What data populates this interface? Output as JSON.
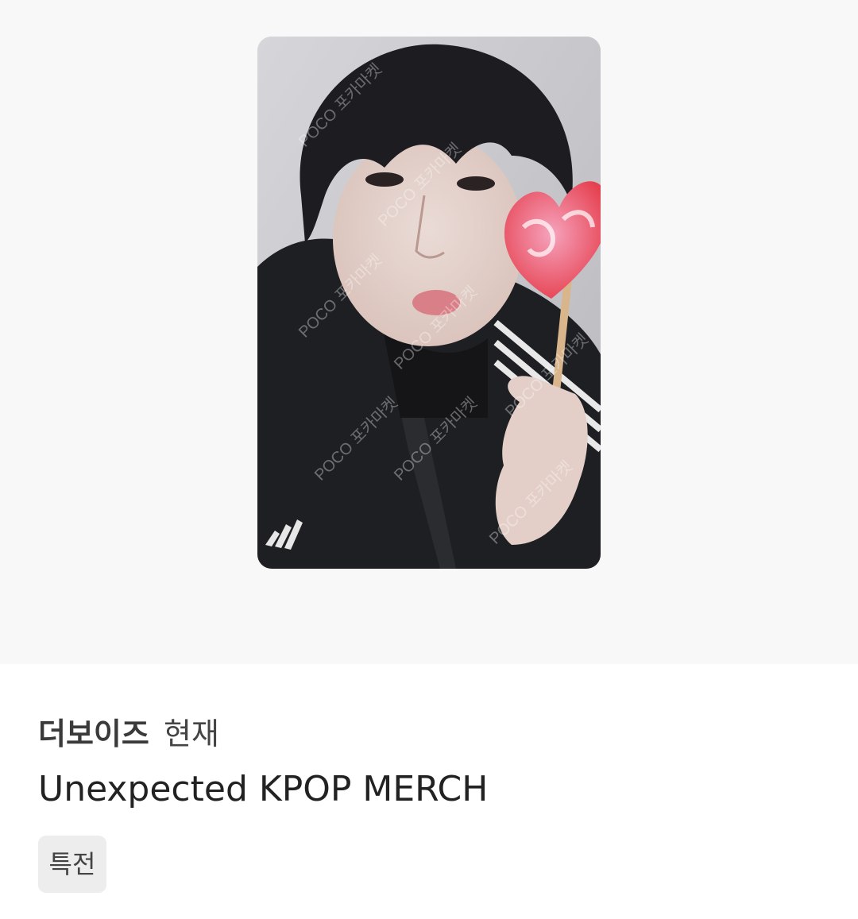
{
  "product": {
    "artist": "더보이즈",
    "member": "현재",
    "name": "Unexpected KPOP MERCH",
    "tag": "특전"
  },
  "image": {
    "watermark": "POCO 포카마켓",
    "brand_icon": "adidas-logo-icon"
  }
}
